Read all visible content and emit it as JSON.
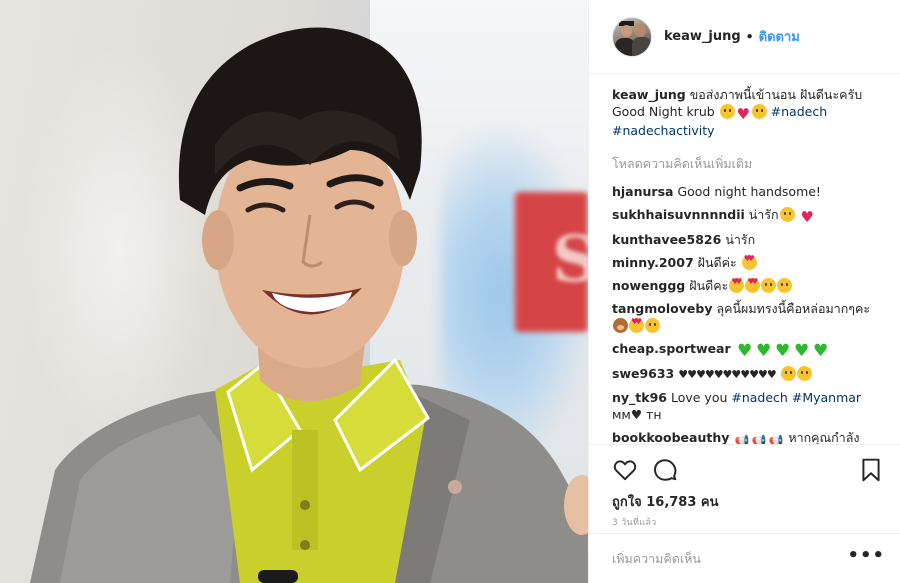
{
  "post": {
    "image_alt": "Smiling man with dark hair wearing a yellow polo shirt and grey blazer"
  },
  "header": {
    "username": "keaw_jung",
    "separator": "•",
    "follow_label": "ติดตาม"
  },
  "caption": {
    "username": "keaw_jung",
    "text": "ขอส่งภาพนี้เข้านอน ฝันดีนะครับ Good Night krub",
    "hashtags": [
      "#nadech",
      "#nadechactivity"
    ]
  },
  "load_more_label": "โหลดความคิดเห็นเพิ่มเติม",
  "comments": [
    {
      "username": "hjanursa",
      "text": "Good night handsome!"
    },
    {
      "username": "sukhhaisuvnnnndii",
      "text": "น่ารัก"
    },
    {
      "username": "kunthavee5826",
      "text": "น่ารัก"
    },
    {
      "username": "minny.2007",
      "text": "ฝันดีค่ะ"
    },
    {
      "username": "nowenggg",
      "text": "ฝันดีคะ"
    },
    {
      "username": "tangmoloveby",
      "text": "ลุคนี้ผมทรงนี้คือหล่อมากๆคะ"
    },
    {
      "username": "cheap.sportwear",
      "text": ""
    },
    {
      "username": "swe9633",
      "text": "♥♥♥♥♥♥♥♥♥♥♥"
    },
    {
      "username": "ny_tk96",
      "text": "Love you",
      "hashtags": [
        "#nadech",
        "#Myanmar"
      ],
      "suffix": "мм♥ тн"
    },
    {
      "username": "bookkoobeauthy",
      "text": "หากคุณกำลังมอง หา"
    }
  ],
  "icons": {
    "like": "heart-outline-icon",
    "comment": "speech-bubble-icon",
    "save": "bookmark-icon",
    "more": "ellipsis-icon"
  },
  "likes": {
    "label": "ถูกใจ 16,783 คน"
  },
  "timestamp": "3 วันที่แล้ว",
  "add_comment": {
    "placeholder": "เพิ่มความคิดเห็น",
    "more_label": "•••"
  },
  "colors": {
    "link_blue": "#3897f0",
    "hashtag": "#003569",
    "muted": "#999999",
    "text": "#262626",
    "shirt_yellow": "#c8cf2a",
    "blazer_grey": "#8e8c88"
  }
}
